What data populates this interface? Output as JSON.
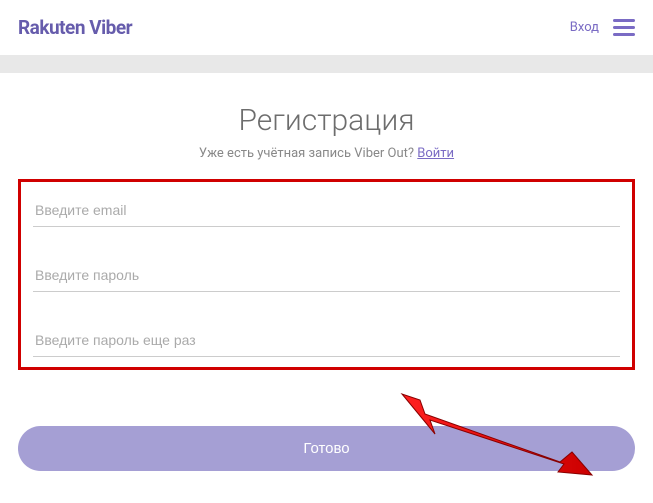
{
  "header": {
    "logo": "Rakuten Viber",
    "login": "Вход"
  },
  "registration": {
    "title": "Регистрация",
    "subtitle_text": "Уже есть учётная запись Viber Out? ",
    "subtitle_link": "Войти",
    "fields": {
      "email_placeholder": "Введите email",
      "password_placeholder": "Введите пароль",
      "password_confirm_placeholder": "Введите пароль еще раз"
    },
    "submit_label": "Готово"
  }
}
